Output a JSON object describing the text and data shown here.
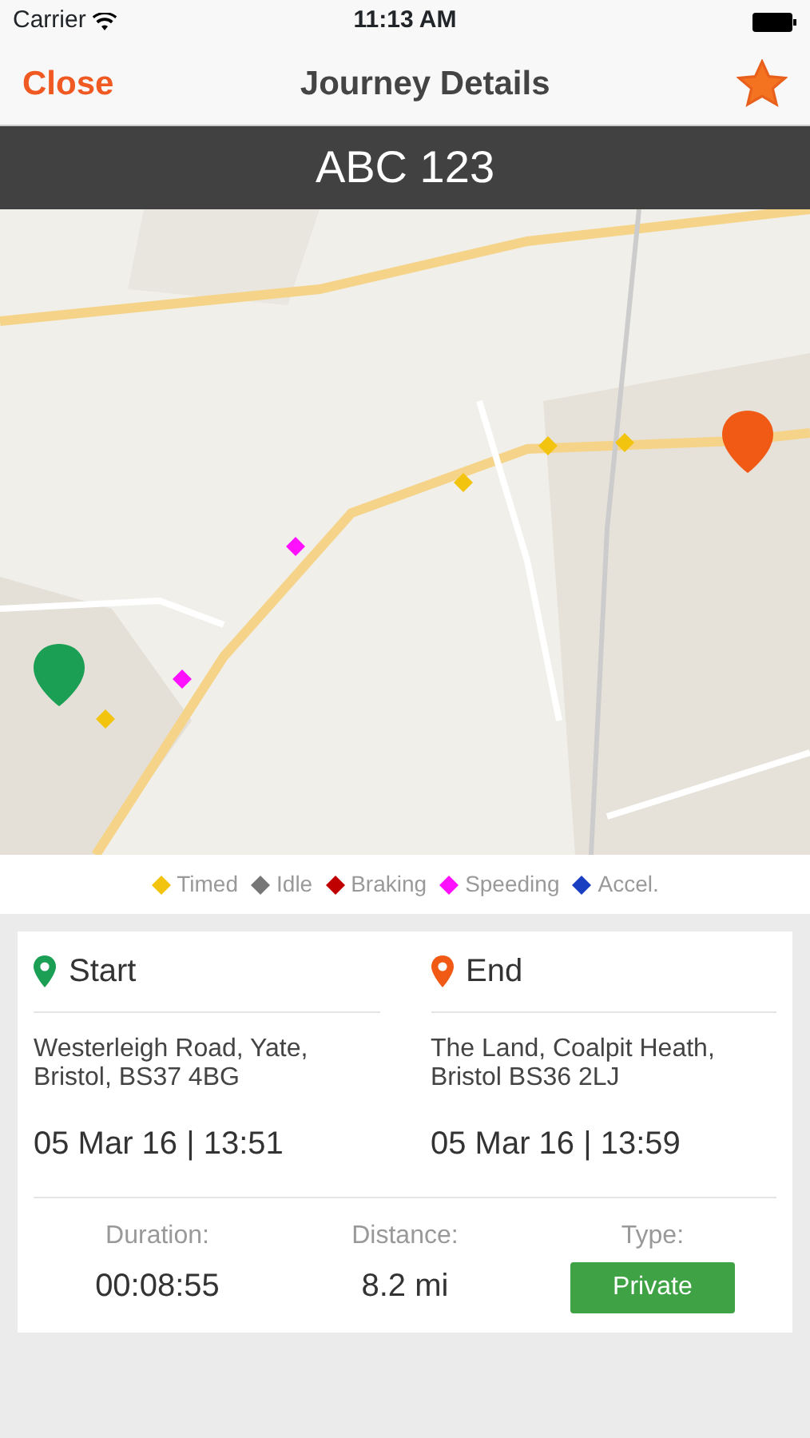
{
  "status_bar": {
    "carrier": "Carrier",
    "time": "11:13 AM"
  },
  "nav": {
    "close": "Close",
    "title": "Journey Details",
    "favorite": true
  },
  "vehicle": {
    "plate": "ABC 123"
  },
  "legend": [
    {
      "label": "Timed",
      "color": "#f2c40f"
    },
    {
      "label": "Idle",
      "color": "#777777"
    },
    {
      "label": "Braking",
      "color": "#c00000"
    },
    {
      "label": "Speeding",
      "color": "#ff10ff"
    },
    {
      "label": "Accel.",
      "color": "#1a3fc0"
    }
  ],
  "endpoints": [
    {
      "kind": "start",
      "title": "Start",
      "address": "Westerleigh Road, Yate, Bristol, BS37 4BG",
      "datetime": "05 Mar 16 | 13:51"
    },
    {
      "kind": "end",
      "title": "End",
      "address": "The Land, Coalpit Heath, Bristol BS36 2LJ",
      "datetime": "05 Mar 16 | 13:59"
    }
  ],
  "stats": [
    {
      "label": "Duration:",
      "value": "00:08:55"
    },
    {
      "label": "Distance:",
      "value": "8.2 mi"
    },
    {
      "label": "Type:",
      "value": "Private",
      "kind": "badge"
    }
  ]
}
